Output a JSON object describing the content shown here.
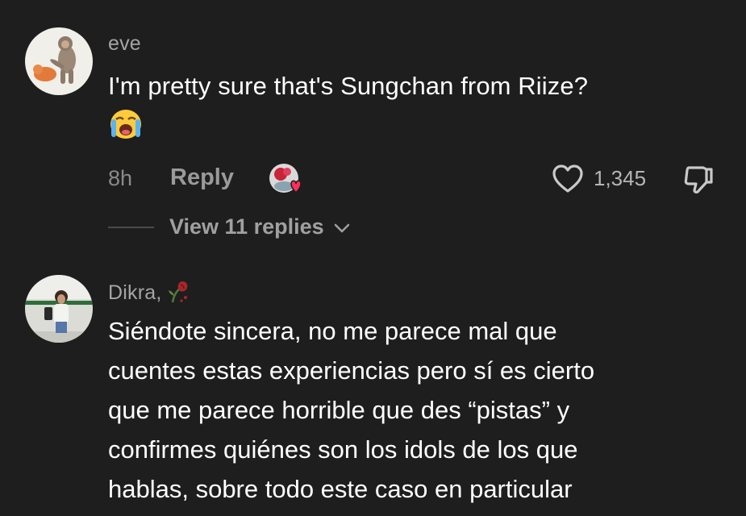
{
  "comments": [
    {
      "username": "eve",
      "text": "I'm pretty sure that's Sungchan from Riize?",
      "emoji": "😭",
      "time": "8h",
      "reply_label": "Reply",
      "like_count": "1,345",
      "view_replies": "View 11 replies"
    },
    {
      "username": "Dikra,",
      "lines": [
        "Siéndote sincera, no me parece mal que",
        "cuentes estas experiencias pero sí es cierto",
        "que me parece horrible que des “pistas” y",
        "confirmes quiénes son los idols de los que",
        "hablas, sobre todo este caso en particular"
      ]
    }
  ],
  "icons": {
    "heart": "heart-outline-icon",
    "dislike": "thumbs-down-icon",
    "chevron": "chevron-down-icon",
    "wilted_rose": "wilted-rose-emoji"
  }
}
